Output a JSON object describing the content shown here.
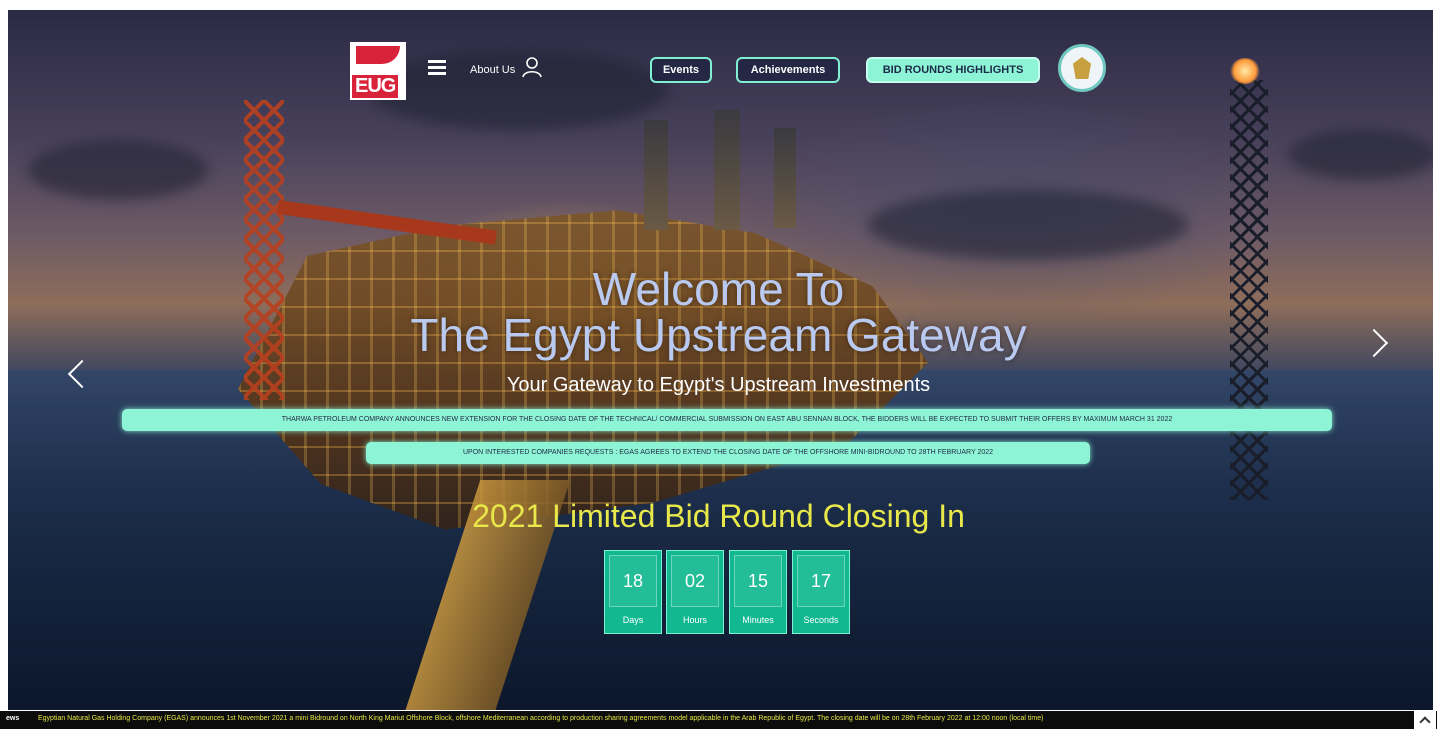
{
  "header": {
    "logo_text": "EUG",
    "about_label": "About Us",
    "nav": {
      "events": "Events",
      "achievements": "Achievements",
      "bid_rounds": "BID ROUNDS HIGHLIGHTS"
    }
  },
  "hero": {
    "title_line1": "Welcome To",
    "title_line2": "The Egypt Upstream Gateway",
    "subtitle": "Your Gateway to Egypt's Upstream Investments",
    "announcements": [
      "THARWA PETROLEUM COMPANY ANNOUNCES NEW EXTENSION FOR THE CLOSING DATE OF THE TECHNICAL/ COMMERCIAL SUBMISSION ON EAST ABU SENNAN BLOCK, THE BIDDERS WILL BE EXPECTED TO SUBMIT THEIR OFFERS BY MAXIMUM MARCH 31 2022",
      "UPON INTERESTED COMPANIES REQUESTS : EGAS AGREES TO EXTEND THE CLOSING DATE OF THE OFFSHORE MINI-BIDROUND TO 28TH FEBRUARY 2022"
    ],
    "closing_title": "2021 Limited Bid Round Closing In",
    "countdown": [
      {
        "value": "18",
        "label": "Days"
      },
      {
        "value": "02",
        "label": "Hours"
      },
      {
        "value": "15",
        "label": "Minutes"
      },
      {
        "value": "17",
        "label": "Seconds"
      }
    ]
  },
  "ticker": {
    "label": "ews",
    "text": "Egyptian Natural Gas Holding Company (EGAS) announces 1st November 2021 a mini Bidround on North King Mariut Offshore Block, offshore Mediterranean according to production sharing agreements model applicable in the Arab Republic of Egypt.  The closing date will be on 28th February 2022 at 12:00 noon (local time)"
  },
  "colors": {
    "accent": "#8df5d5",
    "countdown_bg": "#11b890",
    "closing_text": "#e8e84a",
    "title_text": "#b9c9f0",
    "brand_red": "#d8233a"
  },
  "icons": [
    "menu-icon",
    "user-icon",
    "egypt-seal-icon",
    "chevron-left-icon",
    "chevron-right-icon",
    "chevron-up-icon"
  ]
}
